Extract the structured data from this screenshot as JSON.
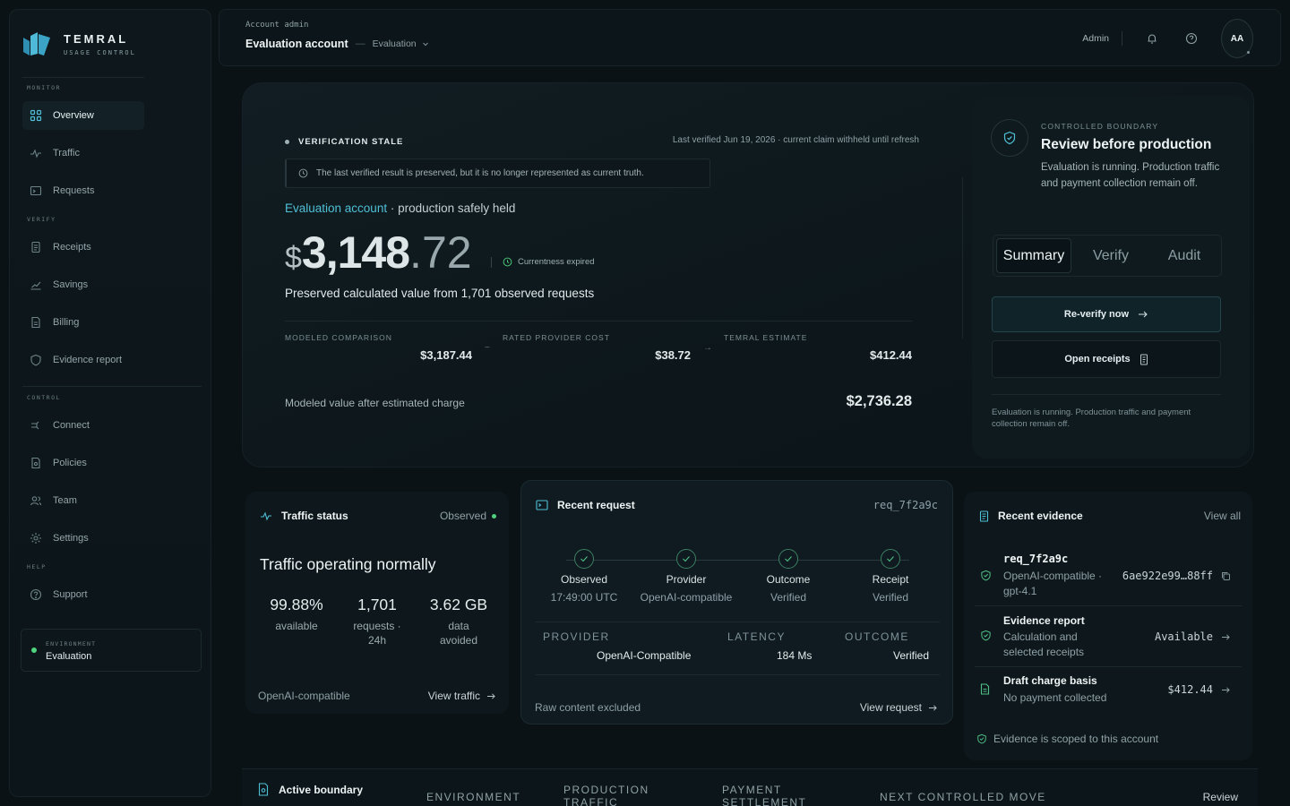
{
  "brand": {
    "name": "TEMRAL",
    "sub": "USAGE CONTROL"
  },
  "sidebar": {
    "sections": {
      "monitor": "MONITOR",
      "verify": "VERIFY",
      "control": "CONTROL",
      "help": "HELP"
    },
    "items": [
      {
        "label": "Overview",
        "icon": "grid-icon"
      },
      {
        "label": "Traffic",
        "icon": "pulse-icon"
      },
      {
        "label": "Requests",
        "icon": "terminal-icon"
      },
      {
        "label": "Receipts",
        "icon": "receipt-icon"
      },
      {
        "label": "Savings",
        "icon": "trend-icon"
      },
      {
        "label": "Billing",
        "icon": "document-icon"
      },
      {
        "label": "Evidence report",
        "icon": "shield-icon"
      },
      {
        "label": "Connect",
        "icon": "plug-icon"
      },
      {
        "label": "Policies",
        "icon": "policy-icon"
      },
      {
        "label": "Team",
        "icon": "users-icon"
      },
      {
        "label": "Settings",
        "icon": "gear-icon"
      },
      {
        "label": "Support",
        "icon": "help-icon"
      }
    ],
    "environment": {
      "label": "ENVIRONMENT",
      "value": "Evaluation"
    }
  },
  "topbar": {
    "account_label": "Account admin",
    "title": "Evaluation account",
    "separator": "—",
    "environment": "Evaluation",
    "admin": "Admin",
    "avatar": "AA"
  },
  "hero": {
    "status": "VERIFICATION STALE",
    "last_verified": "Last verified Jun 19, 2026 · current claim withheld until refresh",
    "warning": "The last verified result is preserved, but it is no longer represented as current truth.",
    "account_link": "Evaluation account",
    "account_suffix": " · production safely held",
    "currency": "$",
    "amount_int": "3,148",
    "amount_dec": ".72",
    "currentness": "Currentness expired",
    "preserved": "Preserved calculated value from 1,701 observed requests",
    "metrics": [
      {
        "label": "MODELED COMPARISON",
        "value": "$3,187.44"
      },
      {
        "label": "RATED PROVIDER COST",
        "value": "$38.72"
      },
      {
        "label": "TEMRAL ESTIMATE",
        "value": "$412.44"
      }
    ],
    "sep_minus": "−",
    "sep_arrow": "→",
    "modeled_after_label": "Modeled value after estimated charge",
    "modeled_after_value": "$2,736.28"
  },
  "boundary": {
    "eyebrow": "CONTROLLED BOUNDARY",
    "title": "Review before production",
    "desc": "Evaluation is running. Production traffic and payment collection remain off.",
    "tabs": [
      "Summary",
      "Verify",
      "Audit"
    ],
    "reverify": "Re-verify now",
    "open_receipts": "Open receipts",
    "note": "Evaluation is running. Production traffic and payment collection remain off."
  },
  "traffic": {
    "title": "Traffic status",
    "chip": "Observed",
    "headline": "Traffic operating normally",
    "stats": [
      {
        "value": "99.88%",
        "label": "available"
      },
      {
        "value": "1,701",
        "label": "requests · 24h"
      },
      {
        "value": "3.62 GB",
        "label": "data avoided"
      }
    ],
    "footer_left": "OpenAI-compatible",
    "footer_right": "View traffic"
  },
  "recent": {
    "title": "Recent request",
    "req_id": "req_7f2a9c",
    "steps": [
      {
        "name": "Observed",
        "sub": "17:49:00 UTC"
      },
      {
        "name": "Provider",
        "sub": "OpenAI-compatible"
      },
      {
        "name": "Outcome",
        "sub": "Verified"
      },
      {
        "name": "Receipt",
        "sub": "Verified"
      }
    ],
    "fields": [
      {
        "label": "PROVIDER",
        "value": "OpenAI-Compatible"
      },
      {
        "label": "LATENCY",
        "value": "184 Ms"
      },
      {
        "label": "OUTCOME",
        "value": "Verified"
      }
    ],
    "footer_left": "Raw content excluded",
    "footer_right": "View request"
  },
  "evidence": {
    "title": "Recent evidence",
    "view_all": "View all",
    "items": [
      {
        "title": "req_7f2a9c",
        "sub": "OpenAI-compatible · gpt-4.1",
        "right": "6ae922e99…88ff"
      },
      {
        "title": "Evidence report",
        "sub": "Calculation and selected receipts",
        "right": "Available"
      },
      {
        "title": "Draft charge basis",
        "sub": "No payment collected",
        "right": "$412.44"
      }
    ],
    "footer": "Evidence is scoped to this account"
  },
  "bottom": {
    "title": "Active boundary",
    "cols": [
      "ENVIRONMENT",
      "PRODUCTION TRAFFIC",
      "PAYMENT SETTLEMENT",
      "NEXT CONTROLLED MOVE"
    ],
    "review": "Review"
  },
  "colors": {
    "accent": "#4fbfd6",
    "ok": "#4fd37f",
    "bg": "#0a1216"
  }
}
